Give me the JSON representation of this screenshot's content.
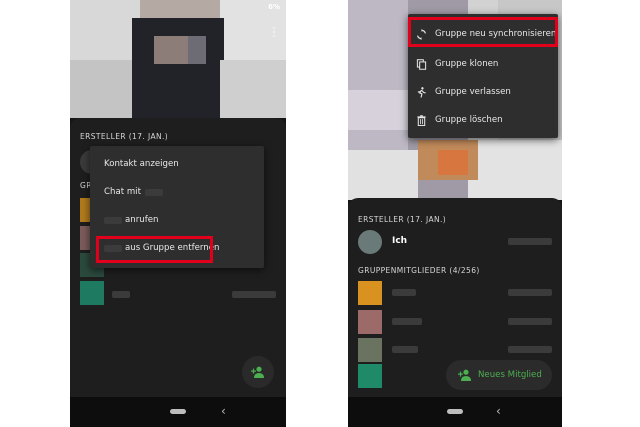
{
  "left_screen": {
    "status_battery": "6%",
    "overflow_icon": "more-vert-icon",
    "creator_section": "ERSTELLER (17. JAN.)",
    "members_section_partial": "GRUPP",
    "context_menu": [
      {
        "label": "Kontakt anzeigen"
      },
      {
        "label": "Chat mit"
      },
      {
        "label": "anrufen"
      },
      {
        "label": "aus Gruppe entfernen",
        "highlighted": true
      }
    ],
    "fab_icon": "person-add-icon",
    "highlight_color": "#e0001b",
    "accent_color": "#4caf50"
  },
  "right_screen": {
    "overflow_menu": [
      {
        "label": "Gruppe neu synchronisieren",
        "icon": "sync-icon",
        "highlighted": true
      },
      {
        "label": "Gruppe klonen",
        "icon": "copy-icon"
      },
      {
        "label": "Gruppe verlassen",
        "icon": "walk-icon"
      },
      {
        "label": "Gruppe löschen",
        "icon": "trash-icon"
      }
    ],
    "creator_section": "ERSTELLER (17. JAN.)",
    "creator_name": "Ich",
    "members_section": "GRUPPENMITGLIEDER (4/256)",
    "new_member_button": "Neues Mitglied",
    "new_member_icon": "person-add-icon"
  }
}
